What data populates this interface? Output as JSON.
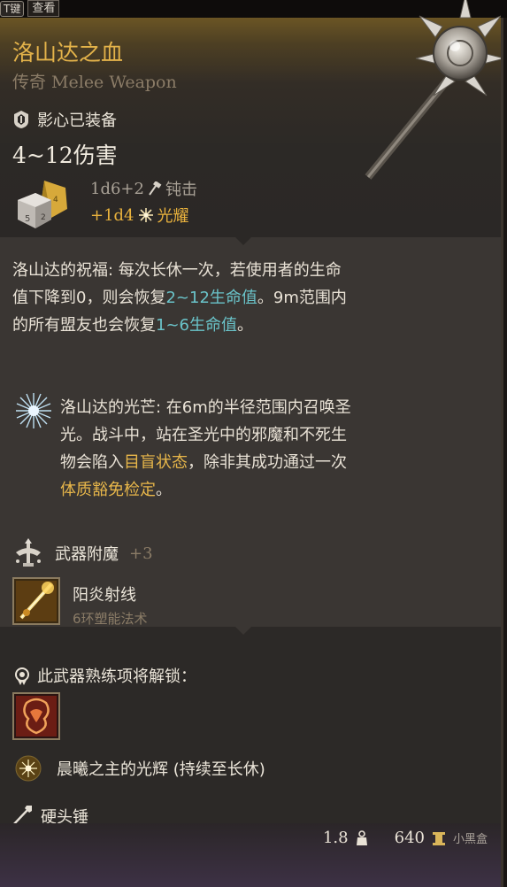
{
  "top_hint": {
    "key": "T键",
    "action": "查看"
  },
  "item": {
    "name": "洛山达之血",
    "rarity": "传奇 Melee Weapon",
    "equip_status": "影心已装备",
    "damage_total": "4~12伤害",
    "damage_lines": [
      {
        "dice": "1d6+2",
        "type": "钝击"
      },
      {
        "dice": "+1d4",
        "type": "光耀"
      }
    ]
  },
  "blessing": {
    "label": "洛山达的祝福",
    "text_a": "每次长休一次，若使用者的生命值下降到0，则会恢复",
    "heal_self": "2~12生命值",
    "text_b": "。9m范围内的所有盟友也会恢复",
    "heal_allies": "1~6生命值",
    "text_c": "。"
  },
  "radiance_feature": {
    "label": "洛山达的光芒",
    "text_a": "在6m的半径范围内召唤圣光。战斗中，站在圣光中的邪魔和不死生物会陷入",
    "status": "目盲状态",
    "text_b": "，除非其成功通过一次",
    "save": "体质豁免检定",
    "text_c": "。"
  },
  "enchant": {
    "label": "武器附魔",
    "bonus": "+3"
  },
  "spell": {
    "name": "阳炎射线",
    "level": "6环塑能法术"
  },
  "proficiency": {
    "unlock_label": "此武器熟练项将解锁：",
    "passive": "晨曦之主的光辉 (持续至长休)"
  },
  "weapon_type": "硬头锤",
  "footer": {
    "weight": "1.8",
    "value": "640",
    "watermark": "小黑盒"
  },
  "colors": {
    "legendary": "#e4b34a",
    "highlight": "#6ac3c9",
    "radiant": "#e9b23d"
  }
}
